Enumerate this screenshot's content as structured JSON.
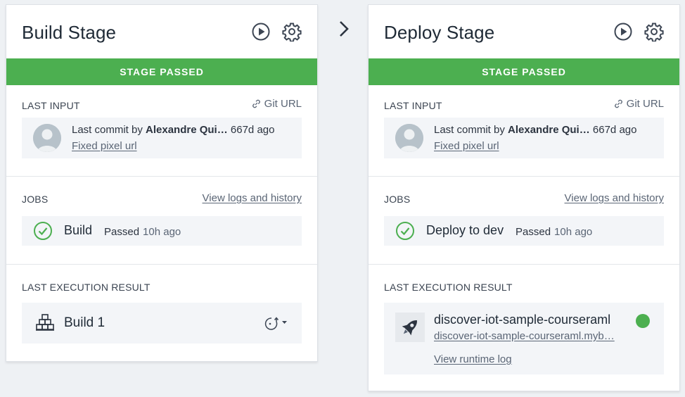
{
  "colors": {
    "stage_passed": "#4caf50",
    "status_running": "#4caf50",
    "link": "#5a6575",
    "tile_bg": "#f3f5f8"
  },
  "stages": {
    "build": {
      "title": "Build Stage",
      "icons": {
        "run": "play-circle-icon",
        "settings": "gear-icon"
      },
      "banner": "STAGE PASSED",
      "last_input": {
        "label": "LAST INPUT",
        "link_label": "Git URL",
        "commit_prefix": "Last commit by ",
        "author": "Alexandre Qui…",
        "age": "667d ago",
        "message": "Fixed pixel url"
      },
      "jobs": {
        "label": "JOBS",
        "link_label": "View logs and history",
        "job_name": "Build",
        "status": "Passed",
        "time": "10h ago"
      },
      "result": {
        "label": "LAST EXECUTION RESULT",
        "name": "Build 1",
        "icon": "build-blocks-icon"
      }
    },
    "deploy": {
      "title": "Deploy Stage",
      "icons": {
        "run": "play-circle-icon",
        "settings": "gear-icon"
      },
      "banner": "STAGE PASSED",
      "last_input": {
        "label": "LAST INPUT",
        "link_label": "Git URL",
        "commit_prefix": "Last commit by ",
        "author": "Alexandre Qui…",
        "age": "667d ago",
        "message": "Fixed pixel url"
      },
      "jobs": {
        "label": "JOBS",
        "link_label": "View logs and history",
        "job_name": "Deploy to dev",
        "status": "Passed",
        "time": "10h ago"
      },
      "result": {
        "label": "LAST EXECUTION RESULT",
        "app_name": "discover-iot-sample-courseraml",
        "app_url": "discover-iot-sample-courseraml.myb…",
        "runtime_log": "View runtime log",
        "icon": "rocket-icon"
      }
    }
  }
}
